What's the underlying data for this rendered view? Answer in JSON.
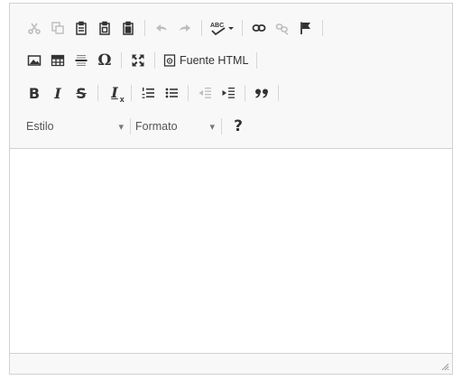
{
  "toolbar": {
    "row1": [
      {
        "icon": "cut-icon",
        "enabled": false
      },
      {
        "icon": "copy-icon",
        "enabled": false
      },
      {
        "icon": "paste-icon",
        "enabled": true
      },
      {
        "icon": "paste-text-icon",
        "enabled": true
      },
      {
        "icon": "paste-from-word-icon",
        "enabled": true
      },
      {
        "icon": "undo-icon",
        "enabled": false
      },
      {
        "icon": "redo-icon",
        "enabled": false
      },
      {
        "icon": "spellcheck-icon",
        "enabled": true,
        "label": "ABC"
      },
      {
        "icon": "link-icon",
        "enabled": true
      },
      {
        "icon": "unlink-icon",
        "enabled": false
      },
      {
        "icon": "anchor-flag-icon",
        "enabled": true
      }
    ],
    "row2": [
      {
        "icon": "image-icon"
      },
      {
        "icon": "table-icon"
      },
      {
        "icon": "horizontal-line-icon"
      },
      {
        "icon": "special-char-icon",
        "glyph": "Ω"
      },
      {
        "icon": "maximize-icon"
      },
      {
        "icon": "source-icon",
        "label": "Fuente HTML"
      }
    ],
    "row3": [
      {
        "icon": "bold-icon",
        "glyph": "B"
      },
      {
        "icon": "italic-icon",
        "glyph": "I"
      },
      {
        "icon": "strike-icon",
        "glyph": "S"
      },
      {
        "icon": "remove-format-icon",
        "glyph": "I"
      },
      {
        "icon": "numbered-list-icon"
      },
      {
        "icon": "bulleted-list-icon"
      },
      {
        "icon": "outdent-icon"
      },
      {
        "icon": "indent-icon"
      },
      {
        "icon": "blockquote-icon",
        "glyph": "99"
      }
    ],
    "row4": {
      "style_label": "Estilo",
      "format_label": "Formato",
      "help_glyph": "?"
    }
  },
  "colors": {
    "toolbar_bg": "#f8f8f8",
    "border": "#d1d1d1",
    "icon": "#333333",
    "icon_disabled": "#bdbdbd"
  }
}
